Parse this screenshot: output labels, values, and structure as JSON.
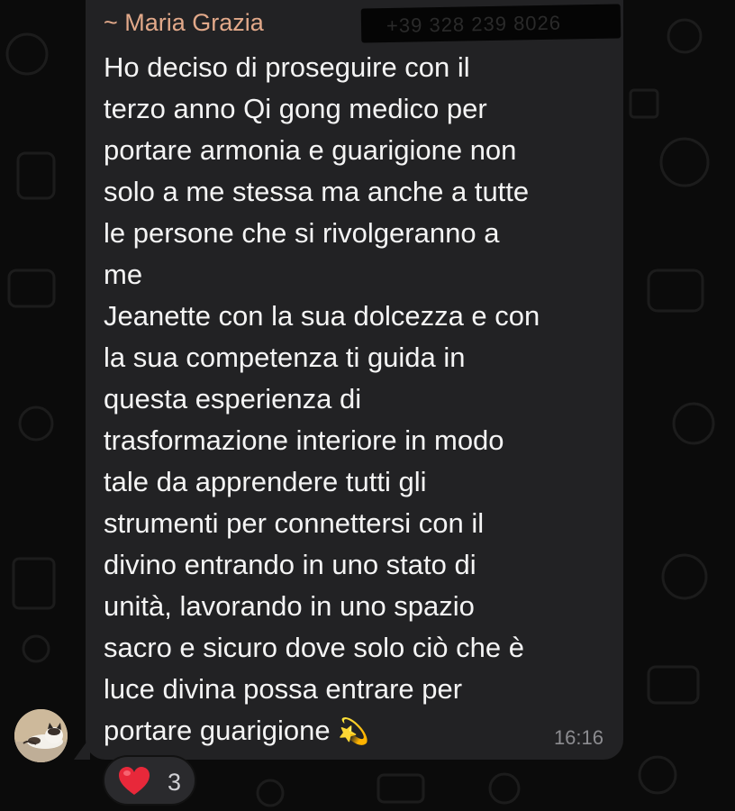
{
  "wallpaper": {
    "icon": "doodle-pattern-icon",
    "color": "#1c1c1c"
  },
  "message": {
    "sender": "~ Maria Grazia",
    "sender_phone_redacted": "+39 328 239 8026",
    "lines": [
      "Ho deciso di proseguire con il",
      "terzo anno Qi gong medico per",
      "portare armonia e guarigione non",
      "solo a me stessa ma anche a tutte",
      "le persone che si rivolgeranno a",
      "me",
      "Jeanette con la sua dolcezza e con",
      "la sua competenza ti guida in",
      "questa esperienza di",
      "trasformazione interiore in modo",
      "tale da apprendere tutti gli",
      "strumenti  per connettersi con il",
      "divino entrando in uno stato di",
      "unità, lavorando in uno spazio",
      "sacro e sicuro dove solo ciò che è",
      "luce divina possa entrare per",
      "portare guarigione "
    ],
    "emoji": "💫",
    "time": "16:16"
  },
  "avatar": {
    "icon": "cat-photo-avatar"
  },
  "reaction": {
    "emoji": "heart-icon",
    "count": "3",
    "color": "#e8283a"
  },
  "colors": {
    "bubble": "#222224",
    "sender_name": "#e2a98a",
    "text": "#f4f4f4",
    "time": "#8c8c90"
  }
}
